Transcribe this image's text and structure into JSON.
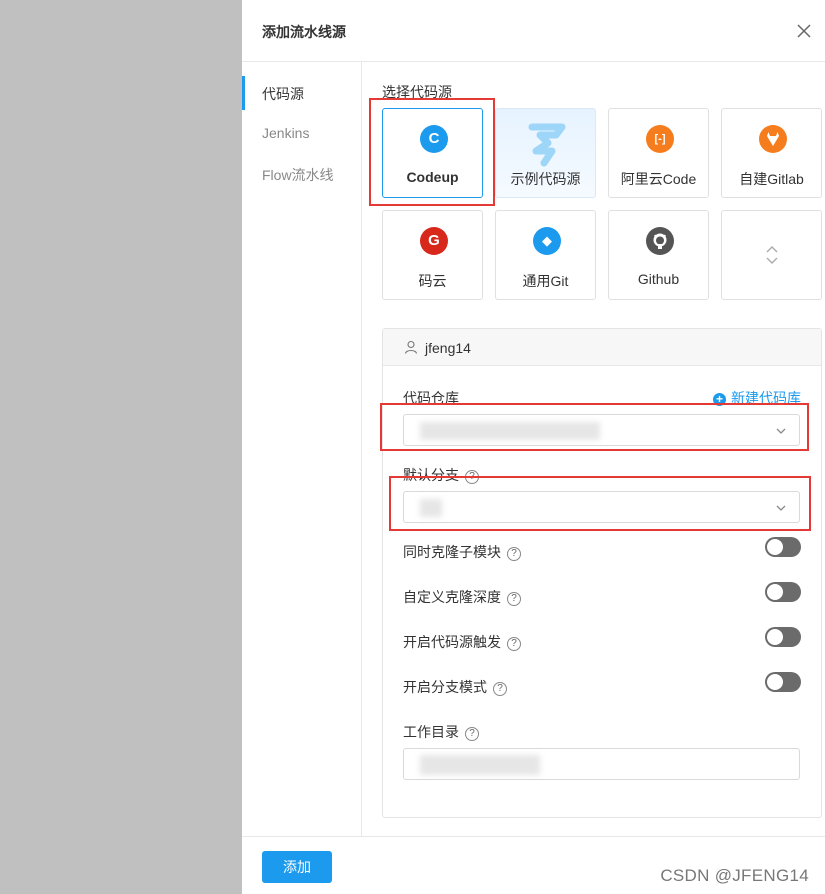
{
  "dialog": {
    "title": "添加流水线源",
    "close_icon": "close-icon"
  },
  "nav": {
    "items": [
      {
        "label": "代码源",
        "active": true
      },
      {
        "label": "Jenkins",
        "active": false
      },
      {
        "label": "Flow流水线",
        "active": false
      }
    ]
  },
  "source_select": {
    "label": "选择代码源",
    "tiles": [
      {
        "label": "Codeup",
        "icon": "codeup-icon",
        "glyph": "C",
        "color": "#1b9aee",
        "selected": true
      },
      {
        "label": "示例代码源",
        "icon": "demo-source-icon",
        "glyph": "",
        "color": "#8fd0f7",
        "selected": false
      },
      {
        "label": "阿里云Code",
        "icon": "aliyun-code-icon",
        "glyph": "[-]",
        "color": "#f57d1e",
        "selected": false
      },
      {
        "label": "自建Gitlab",
        "icon": "gitlab-icon",
        "glyph": "",
        "color": "#f57d1e",
        "selected": false
      },
      {
        "label": "码云",
        "icon": "gitee-icon",
        "glyph": "G",
        "color": "#d7281b",
        "selected": false
      },
      {
        "label": "通用Git",
        "icon": "git-icon",
        "glyph": "◆",
        "color": "#1b9aee",
        "selected": false
      },
      {
        "label": "Github",
        "icon": "github-icon",
        "glyph": "",
        "color": "#555555",
        "selected": false
      },
      {
        "label": "",
        "icon": "expand-icon",
        "glyph": "",
        "color": "",
        "selected": false
      }
    ]
  },
  "account": {
    "username": "jfeng14",
    "icon": "user-icon"
  },
  "repo": {
    "label": "代码仓库",
    "new_repo_label": "新建代码库",
    "value": ""
  },
  "branch": {
    "label": "默认分支",
    "value": ""
  },
  "toggles": [
    {
      "label": "同时克隆子模块",
      "on": false
    },
    {
      "label": "自定义克隆深度",
      "on": false
    },
    {
      "label": "开启代码源触发",
      "on": false
    },
    {
      "label": "开启分支模式",
      "on": false
    }
  ],
  "workdir": {
    "label": "工作目录",
    "value": ""
  },
  "footer": {
    "add_label": "添加"
  },
  "watermark": "CSDN @JFENG14",
  "colors": {
    "accent": "#1b9aee",
    "highlight_box": "#e53935",
    "toggle_off": "#6b6b6b",
    "backdrop": "#c0c0c0"
  }
}
